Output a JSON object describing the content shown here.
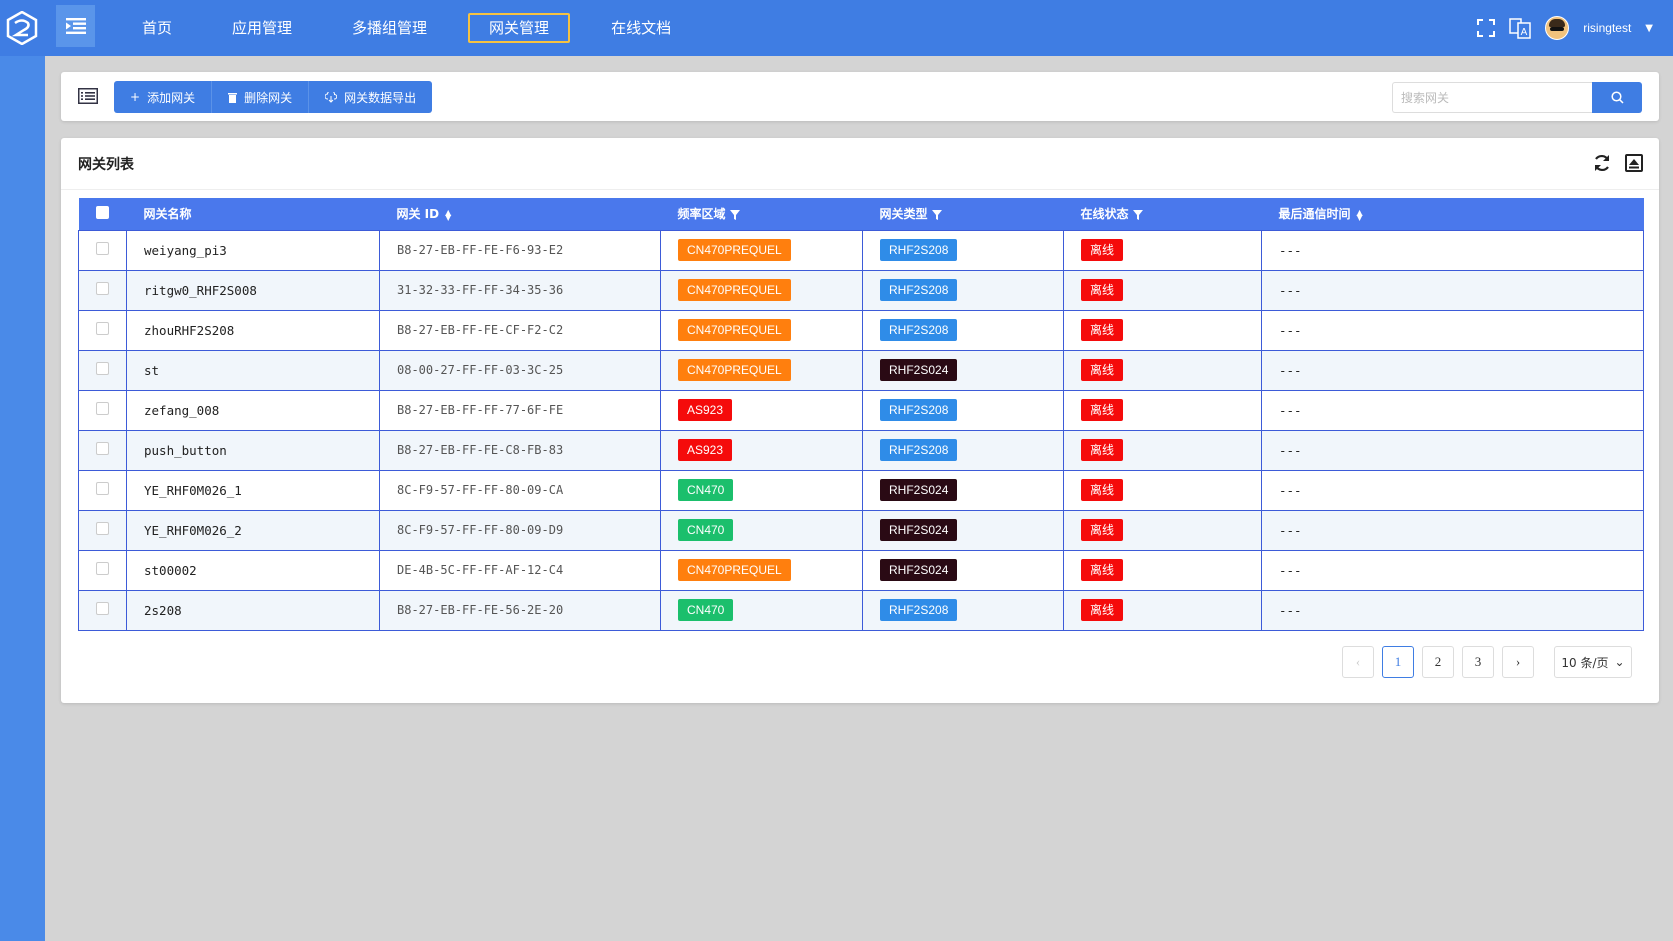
{
  "nav": {
    "items": [
      {
        "label": "首页"
      },
      {
        "label": "应用管理"
      },
      {
        "label": "多播组管理"
      },
      {
        "label": "网关管理",
        "active": true
      },
      {
        "label": "在线文档"
      }
    ]
  },
  "user": {
    "name": "risingtest"
  },
  "toolbar": {
    "add_label": "添加网关",
    "delete_label": "删除网关",
    "export_label": "网关数据导出",
    "search_placeholder": "搜索网关"
  },
  "card": {
    "title": "网关列表"
  },
  "table": {
    "headers": {
      "name": "网关名称",
      "id": "网关 ID",
      "region": "频率区域",
      "type": "网关类型",
      "status": "在线状态",
      "last": "最后通信时间"
    },
    "rows": [
      {
        "name": "weiyang_pi3",
        "id": "B8-27-EB-FF-FE-F6-93-E2",
        "region": "CN470PREQUEL",
        "type": "RHF2S208",
        "status": "离线",
        "last": "---"
      },
      {
        "name": "ritgw0_RHF2S008",
        "id": "31-32-33-FF-FF-34-35-36",
        "region": "CN470PREQUEL",
        "type": "RHF2S208",
        "status": "离线",
        "last": "---"
      },
      {
        "name": "zhouRHF2S208",
        "id": "B8-27-EB-FF-FE-CF-F2-C2",
        "region": "CN470PREQUEL",
        "type": "RHF2S208",
        "status": "离线",
        "last": "---"
      },
      {
        "name": "st",
        "id": "08-00-27-FF-FF-03-3C-25",
        "region": "CN470PREQUEL",
        "type": "RHF2S024",
        "status": "离线",
        "last": "---"
      },
      {
        "name": "zefang_008",
        "id": "B8-27-EB-FF-FF-77-6F-FE",
        "region": "AS923",
        "type": "RHF2S208",
        "status": "离线",
        "last": "---"
      },
      {
        "name": "push_button",
        "id": "B8-27-EB-FF-FE-C8-FB-83",
        "region": "AS923",
        "type": "RHF2S208",
        "status": "离线",
        "last": "---"
      },
      {
        "name": "YE_RHF0M026_1",
        "id": "8C-F9-57-FF-FF-80-09-CA",
        "region": "CN470",
        "type": "RHF2S024",
        "status": "离线",
        "last": "---"
      },
      {
        "name": "YE_RHF0M026_2",
        "id": "8C-F9-57-FF-FF-80-09-D9",
        "region": "CN470",
        "type": "RHF2S024",
        "status": "离线",
        "last": "---"
      },
      {
        "name": "st00002",
        "id": "DE-4B-5C-FF-FF-AF-12-C4",
        "region": "CN470PREQUEL",
        "type": "RHF2S024",
        "status": "离线",
        "last": "---"
      },
      {
        "name": "2s208",
        "id": "B8-27-EB-FF-FE-56-2E-20",
        "region": "CN470",
        "type": "RHF2S208",
        "status": "离线",
        "last": "---"
      }
    ]
  },
  "tag_colors": {
    "CN470PREQUEL": "#ff7f0e",
    "AS923": "#f50b0b",
    "CN470": "#1bbf6c",
    "RHF2S208": "#2f8ce8",
    "RHF2S024": "#2a0a14",
    "离线": "#f50b0b"
  },
  "pagination": {
    "pages": [
      "1",
      "2",
      "3"
    ],
    "current": "1",
    "page_size": "10 条/页"
  },
  "colors": {
    "primary": "#3f7de3",
    "header": "#4a78ec"
  }
}
